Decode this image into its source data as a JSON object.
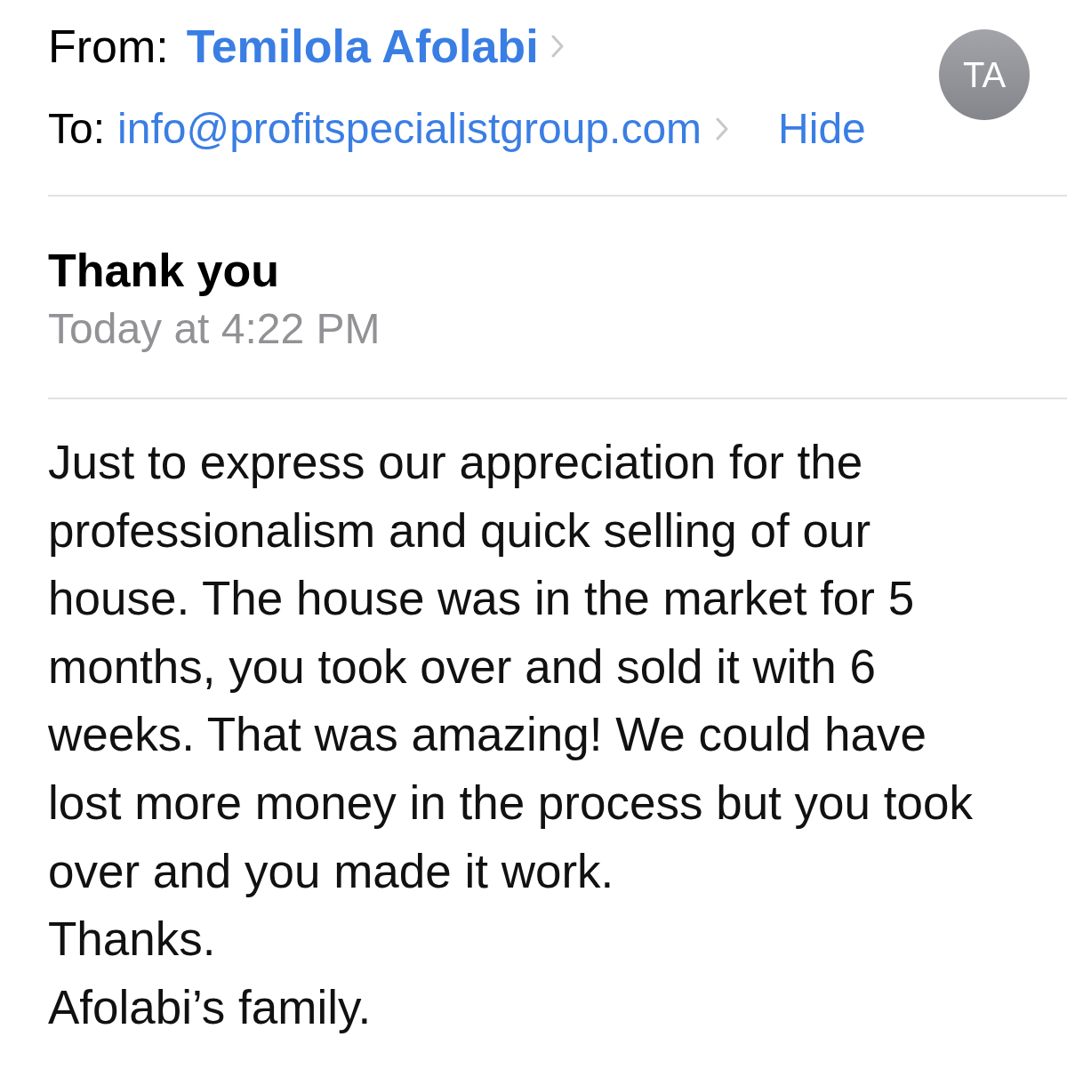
{
  "header": {
    "from": {
      "label": "From:",
      "name": "Temilola Afolabi"
    },
    "to": {
      "label": "To:",
      "address": "info@profitspecialistgroup.com"
    },
    "hide_link": "Hide",
    "avatar": {
      "initials": "TA"
    }
  },
  "message": {
    "subject": "Thank you",
    "date": "Today at 4:22 PM",
    "body": [
      "Just to express our appreciation for the professionalism and quick selling of our house. The house was in the market for 5 months, you took over and sold it with 6 weeks. That was amazing! We could have lost more money in the process but you took over and you made it work.",
      "Thanks.",
      "Afolabi’s family."
    ]
  }
}
